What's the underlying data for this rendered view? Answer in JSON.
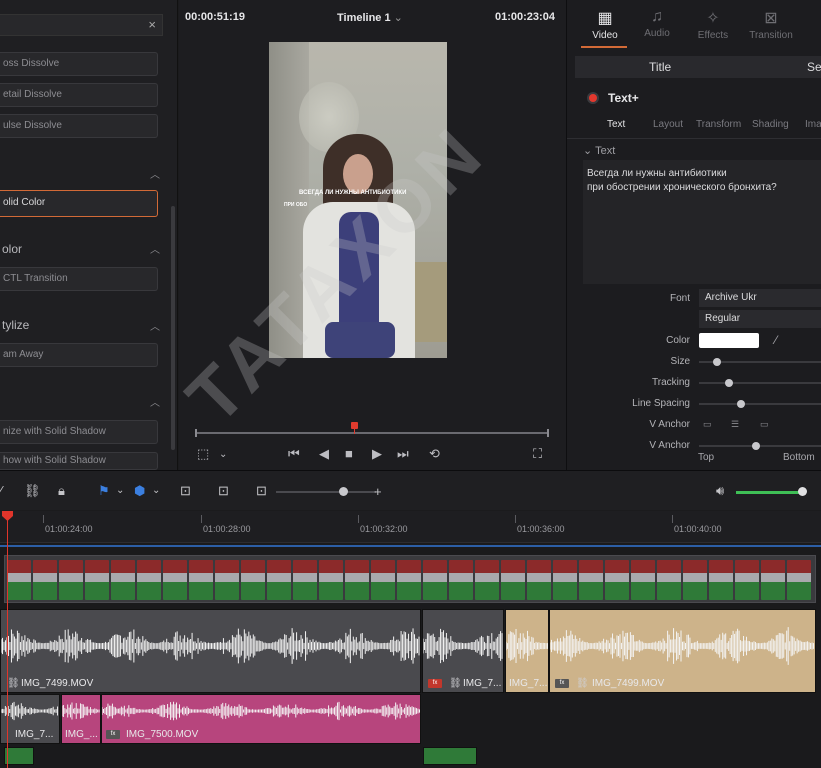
{
  "effects_panel": {
    "items": [
      {
        "label": "oss Dissolve"
      },
      {
        "label": "etail Dissolve"
      },
      {
        "label": "ulse Dissolve"
      },
      {
        "label": "olid Color"
      },
      {
        "label": "CTL Transition"
      },
      {
        "label": "am Away"
      },
      {
        "label": "nize with Solid Shadow"
      },
      {
        "label": "how with Solid Shadow"
      }
    ],
    "sections": [
      "olor",
      "tylize"
    ],
    "search_clear": "×"
  },
  "viewer": {
    "timecode_left": "00:00:51:19",
    "timeline_name": "Timeline 1",
    "timecode_right": "01:00:23:04",
    "caption_line1": "ВСЕГДА ЛИ НУЖНЫ АНТИБИОТИКИ",
    "caption_line2": "ПРИ ОБО"
  },
  "inspector": {
    "tabs": [
      {
        "label": "Video",
        "icon": "film-icon"
      },
      {
        "label": "Audio",
        "icon": "music-icon"
      },
      {
        "label": "Effects",
        "icon": "wand-icon"
      },
      {
        "label": "Transition",
        "icon": "transition-icon"
      }
    ],
    "subtabs": [
      "Title",
      "Set"
    ],
    "title_name": "Text+",
    "text_tabs": [
      "Text",
      "Layout",
      "Transform",
      "Shading",
      "Ima"
    ],
    "text_section": "Text",
    "text_line1": "Всегда ли нужны антибиотики",
    "text_line2": "при обострении хронического бронхита?",
    "font_label": "Font",
    "font_value": "Archive Ukr",
    "style_value": "Regular",
    "color_label": "Color",
    "color_value": "#ffffff",
    "size_label": "Size",
    "tracking_label": "Tracking",
    "line_spacing_label": "Line Spacing",
    "v_anchor_label": "V Anchor",
    "v_anchor_label2": "V Anchor",
    "anchor_top": "Top",
    "anchor_bottom": "Bottom",
    "size_level": 0.12,
    "tracking_level": 0.23,
    "line_spacing_level": 0.33,
    "v_anchor_level": 0.46
  },
  "timeline": {
    "ruler_labels": [
      "01:00:24:00",
      "01:00:28:00",
      "01:00:32:00",
      "01:00:36:00",
      "01:00:40:00"
    ],
    "clips": [
      {
        "label": "IMG_7499.MOV"
      },
      {
        "label": "IMG_7..."
      },
      {
        "label": "IMG_7..."
      },
      {
        "label": "IMG_7499.MOV"
      },
      {
        "label": "IMG_7..."
      },
      {
        "label": "IMG_..."
      },
      {
        "label": "IMG_7500.MOV"
      }
    ],
    "fx_badge": "fx",
    "volume_level": 0.9
  },
  "watermark": "TATAXON",
  "colors": {
    "accent": "#d26a37",
    "playhead": "#e0352b",
    "audio_grey": "#4a4a4e",
    "audio_tan": "#cdb38a",
    "audio_pink": "#b7457d"
  }
}
